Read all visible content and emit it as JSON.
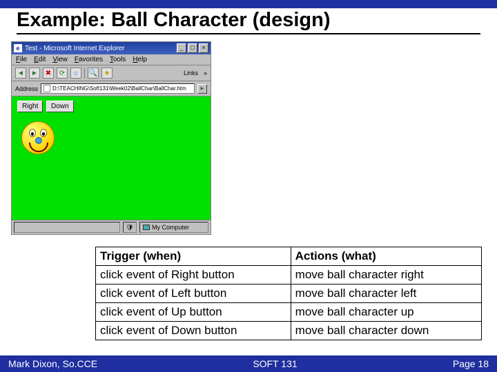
{
  "slide": {
    "title": "Example: Ball Character (design)"
  },
  "browser": {
    "window_title": "Test - Microsoft Internet Explorer",
    "menus": [
      "File",
      "Edit",
      "View",
      "Favorites",
      "Tools",
      "Help"
    ],
    "links_label": "Links",
    "address_label": "Address",
    "address_value": "D:\\TEACHING\\Soft131\\Week02\\BallChar\\BallChar.htm",
    "buttons": {
      "b1": "Right",
      "b2": "Down"
    },
    "status_zone": "My Computer",
    "winbtns": {
      "min": "_",
      "max": "□",
      "close": "×"
    }
  },
  "table": {
    "headers": {
      "trigger": "Trigger (when)",
      "actions": "Actions (what)"
    },
    "rows": [
      {
        "trigger": "click event of Right button",
        "action": "move ball character right"
      },
      {
        "trigger": "click event of Left button",
        "action": "move ball character left"
      },
      {
        "trigger": "click event of Up button",
        "action": "move ball character up"
      },
      {
        "trigger": "click event of Down button",
        "action": "move ball character down"
      }
    ]
  },
  "footer": {
    "left": "Mark Dixon, So.CCE",
    "center": "SOFT 131",
    "right": "Page 18"
  }
}
